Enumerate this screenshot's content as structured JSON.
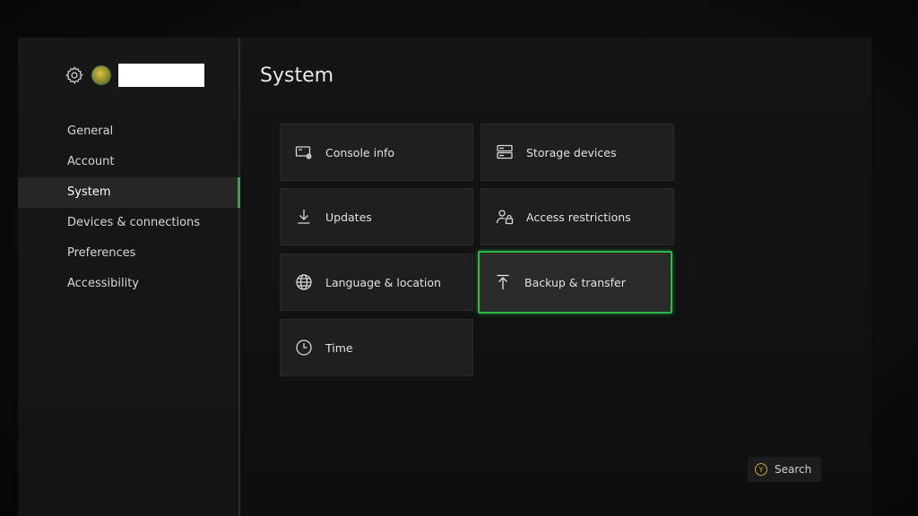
{
  "header": {
    "settings_icon": "gear-icon",
    "avatar_icon": "gamerpic-avatar",
    "gamertag": ""
  },
  "sidebar": {
    "items": [
      {
        "label": "General",
        "active": false
      },
      {
        "label": "Account",
        "active": false
      },
      {
        "label": "System",
        "active": true
      },
      {
        "label": "Devices & connections",
        "active": false
      },
      {
        "label": "Preferences",
        "active": false
      },
      {
        "label": "Accessibility",
        "active": false
      }
    ]
  },
  "main": {
    "title": "System",
    "tiles": [
      {
        "label": "Console info",
        "icon": "console-info-icon"
      },
      {
        "label": "Storage devices",
        "icon": "storage-icon"
      },
      {
        "label": "Updates",
        "icon": "download-icon"
      },
      {
        "label": "Access restrictions",
        "icon": "user-lock-icon"
      },
      {
        "label": "Language & location",
        "icon": "globe-icon"
      },
      {
        "label": "Backup & transfer",
        "icon": "upload-icon",
        "focused": true
      },
      {
        "label": "Time",
        "icon": "clock-icon"
      }
    ]
  },
  "footer": {
    "search_button_glyph": "Y",
    "search_label": "Search"
  },
  "colors": {
    "accent": "#2fb94d",
    "background": "#121212",
    "tile": "#1f1f1f",
    "y_button": "#c9a238"
  }
}
